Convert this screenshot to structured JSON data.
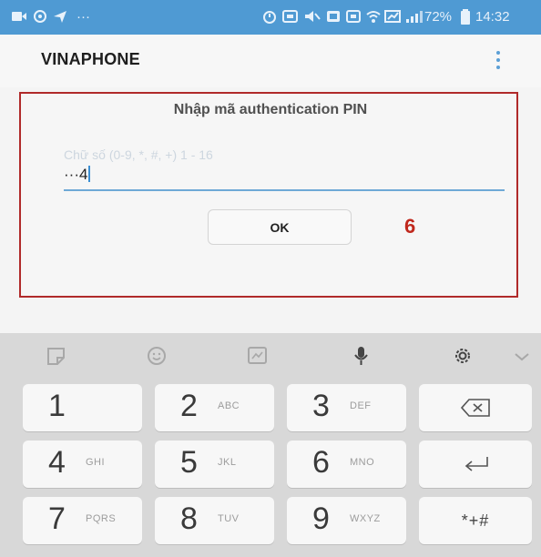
{
  "status_bar": {
    "battery_percent_text": "72%",
    "time": "14:32",
    "ellipsis": "···",
    "background_color": "#4f9ad3"
  },
  "app_bar": {
    "title": "VINAPHONE",
    "menu_icon": "overflow-menu-icon"
  },
  "dialog": {
    "title": "Nhập mã authentication PIN",
    "pin_input": {
      "placeholder": "Chữ số (0-9, *, #, +) 1 - 16",
      "value": "···4"
    },
    "ok_label": "OK",
    "step_marker": "6",
    "highlight_color": "#b02a2a"
  },
  "keyboard": {
    "toolbar_icons": [
      "sticker-icon",
      "emoji-icon",
      "gif-icon",
      "microphone-icon",
      "settings-icon",
      "chevron-down-icon"
    ],
    "keys": [
      {
        "digit": "1",
        "letters": ""
      },
      {
        "digit": "2",
        "letters": "ABC"
      },
      {
        "digit": "3",
        "letters": "DEF"
      },
      {
        "digit": "4",
        "letters": "GHI"
      },
      {
        "digit": "5",
        "letters": "JKL"
      },
      {
        "digit": "6",
        "letters": "MNO"
      },
      {
        "digit": "7",
        "letters": "PQRS"
      },
      {
        "digit": "8",
        "letters": "TUV"
      },
      {
        "digit": "9",
        "letters": "WXYZ"
      }
    ],
    "symbols_label": "*+#",
    "backspace_icon": "backspace-icon",
    "enter_icon": "enter-icon"
  }
}
